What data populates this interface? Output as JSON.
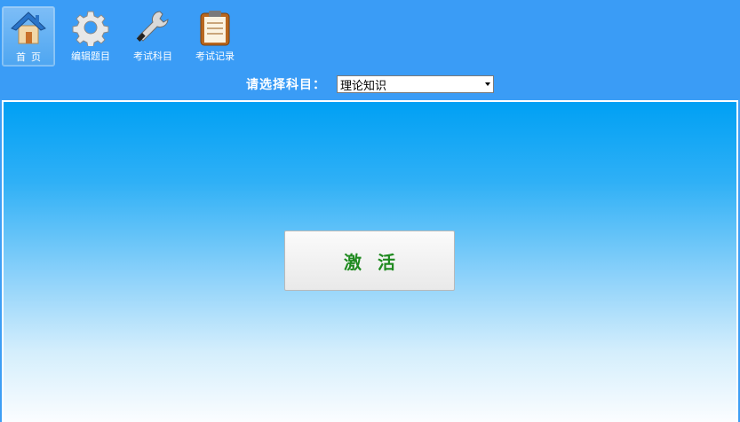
{
  "toolbar": {
    "items": [
      {
        "label": "首页",
        "icon": "home-icon",
        "active": true
      },
      {
        "label": "编辑题目",
        "icon": "gear-icon",
        "active": false
      },
      {
        "label": "考试科目",
        "icon": "wrench-icon",
        "active": false
      },
      {
        "label": "考试记录",
        "icon": "clipboard-icon",
        "active": false
      }
    ]
  },
  "subject": {
    "label": "请选择科目：",
    "selected": "理论知识"
  },
  "main": {
    "activate_label": "激活"
  },
  "colors": {
    "topbar": "#3a9cf6",
    "gradient_top": "#00a0f4",
    "gradient_bottom": "#fbfdff",
    "button_text": "#1f8a1f"
  }
}
